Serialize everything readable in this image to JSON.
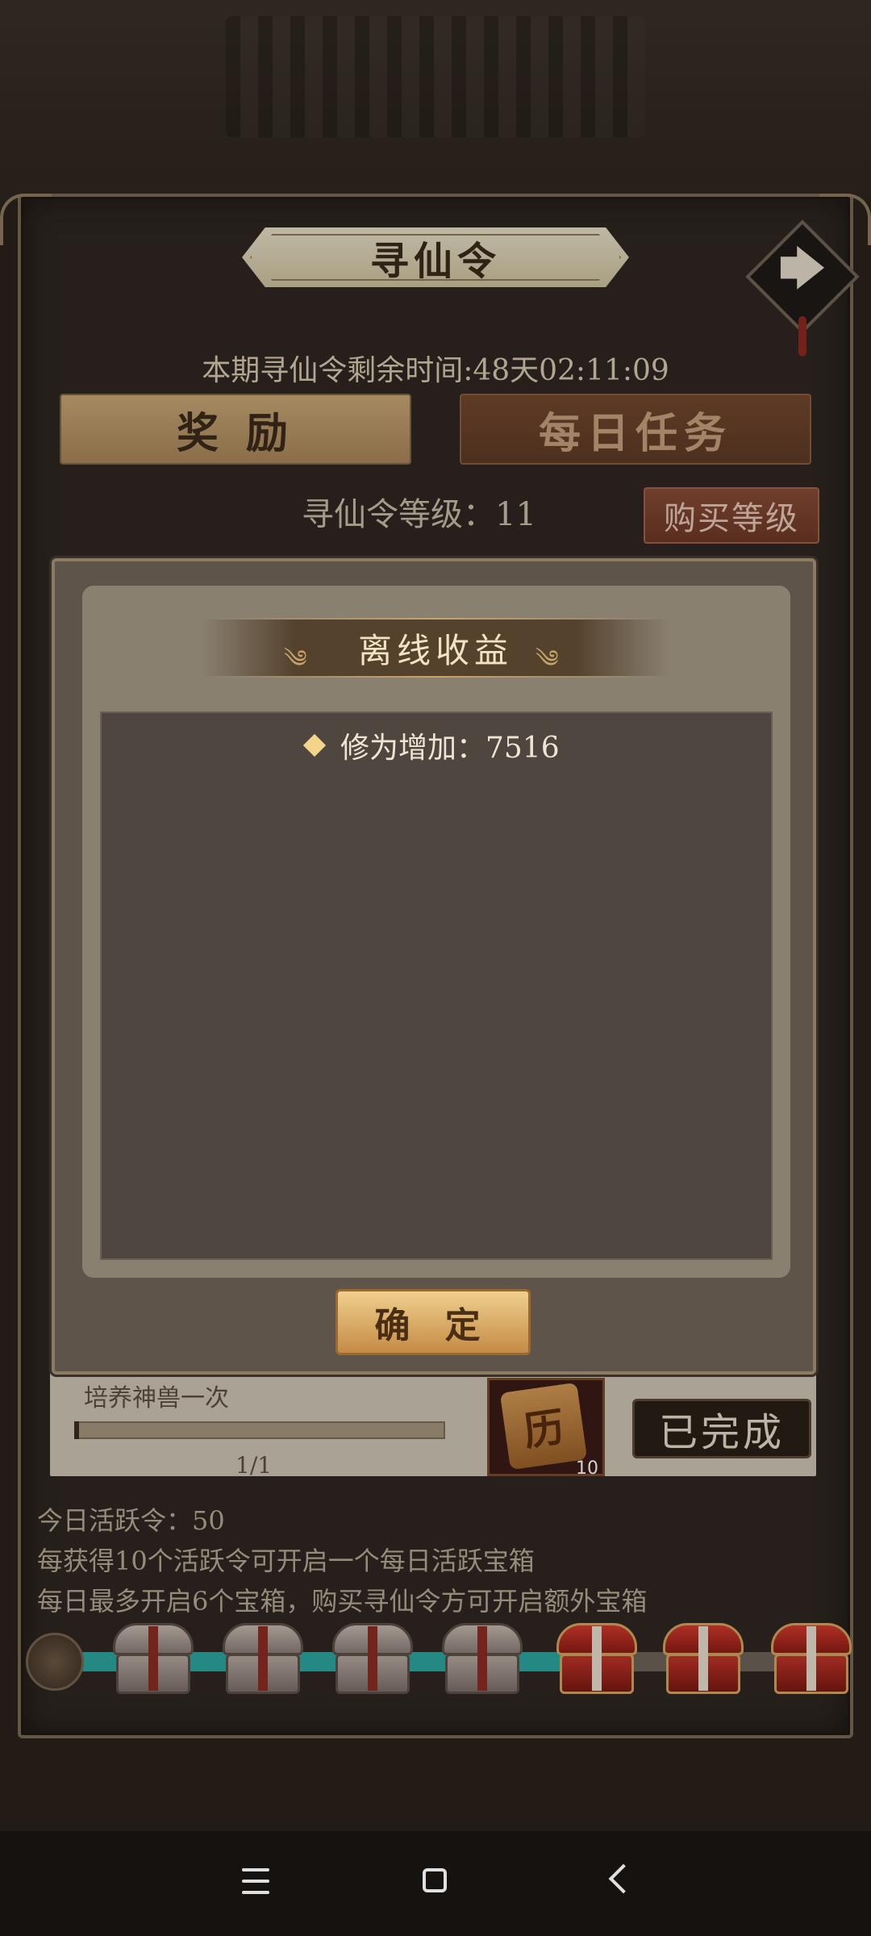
{
  "header": {
    "title": "寻仙令",
    "period_text": "本期寻仙令剩余时间:48天02:11:09"
  },
  "tabs": [
    {
      "label": "奖 励",
      "active": true
    },
    {
      "label": "每日任务",
      "active": false
    }
  ],
  "level": {
    "text": "寻仙令等级：11",
    "buy_label": "购买等级"
  },
  "task": {
    "name": "培养神兽一次",
    "progress": "1/1",
    "progress_fraction": 1,
    "reward_glyph": "历",
    "reward_count": "10",
    "status_label": "已完成"
  },
  "info": {
    "line1": "今日活跃令：50",
    "line2": "每获得10个活跃令可开启一个每日活跃宝箱",
    "line3": "每日最多开启6个宝箱，购买寻仙令方可开启额外宝箱"
  },
  "chests": {
    "opened_count": 4,
    "total": 7,
    "progress_color": "#2ea8a0"
  },
  "modal": {
    "title": "离线收益",
    "swirl_left": "༄",
    "swirl_right": "༄",
    "reward_line": "修为增加：7516",
    "confirm_label": "确 定"
  },
  "icons": {
    "next_arrow": "🡆"
  }
}
